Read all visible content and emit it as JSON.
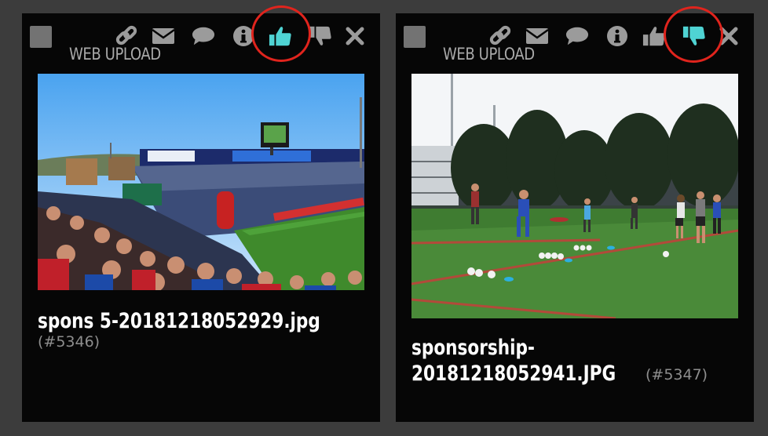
{
  "colors": {
    "icon_gray": "#9b9b9b",
    "icon_active": "#4fd3d3",
    "ring_red": "#e0241d",
    "card_bg": "#060606",
    "page_bg": "#3c3c3c"
  },
  "cards": [
    {
      "source_label": "WEB UPLOAD",
      "file_name": "spons 5-20181218052929.jpg",
      "file_id": "(#5346)",
      "toolbar": [
        "select-checkbox",
        "link-icon",
        "mail-icon",
        "comment-icon",
        "info-icon",
        "thumbs-up-icon",
        "thumbs-down-icon",
        "close-icon"
      ],
      "active_action": "thumbs-up"
    },
    {
      "source_label": "WEB UPLOAD",
      "file_name_line1": "sponsorship-",
      "file_name_line2": "20181218052941.JPG",
      "file_id": "(#5347)",
      "toolbar": [
        "select-checkbox",
        "link-icon",
        "mail-icon",
        "comment-icon",
        "info-icon",
        "thumbs-up-icon",
        "thumbs-down-icon",
        "close-icon"
      ],
      "active_action": "thumbs-down"
    }
  ]
}
